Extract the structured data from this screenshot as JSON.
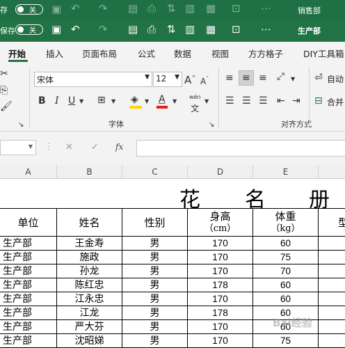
{
  "window1": {
    "autosave_label": "存",
    "toggle": "关",
    "workbook": "销售部"
  },
  "window2": {
    "autosave_label": "保存",
    "toggle": "关",
    "workbook": "生产部"
  },
  "ribbon": {
    "tabs": [
      "开始",
      "插入",
      "页面布局",
      "公式",
      "数据",
      "视图",
      "方方格子",
      "DIY工具箱"
    ],
    "font_name": "宋体",
    "font_size": "12",
    "font_group_label": "字体",
    "align_group_label": "对齐方式",
    "auto_wrap": "自动",
    "merge": "合并",
    "wen": "wén",
    "bold": "B",
    "italic": "I",
    "underline": "U",
    "grow": "A",
    "shrink": "A",
    "colors": {
      "accent": "#217346",
      "highlight": "#ffd800",
      "font_color": "#e0201b"
    }
  },
  "formula_bar": {
    "fx": "fx",
    "cancel": "✕",
    "enter": "✓"
  },
  "sheet": {
    "columns": [
      "A",
      "B",
      "C",
      "D",
      "E"
    ],
    "title": [
      "花",
      "名",
      "册"
    ],
    "headers": [
      "单位",
      "姓名",
      "性别",
      "身高",
      "体重",
      "型"
    ],
    "header_units": [
      "（cm）",
      "（kg）"
    ],
    "rows": [
      [
        "生产部",
        "王金寿",
        "男",
        "170",
        "60"
      ],
      [
        "生产部",
        "施政",
        "男",
        "170",
        "75"
      ],
      [
        "生产部",
        "孙龙",
        "男",
        "170",
        "70"
      ],
      [
        "生产部",
        "陈红忠",
        "男",
        "178",
        "60"
      ],
      [
        "生产部",
        "江永忠",
        "男",
        "170",
        "60"
      ],
      [
        "生产部",
        "江龙",
        "男",
        "178",
        "60"
      ],
      [
        "生产部",
        "严大芬",
        "男",
        "170",
        "60"
      ],
      [
        "生产部",
        "沈昭娣",
        "男",
        "170",
        "75"
      ]
    ]
  }
}
